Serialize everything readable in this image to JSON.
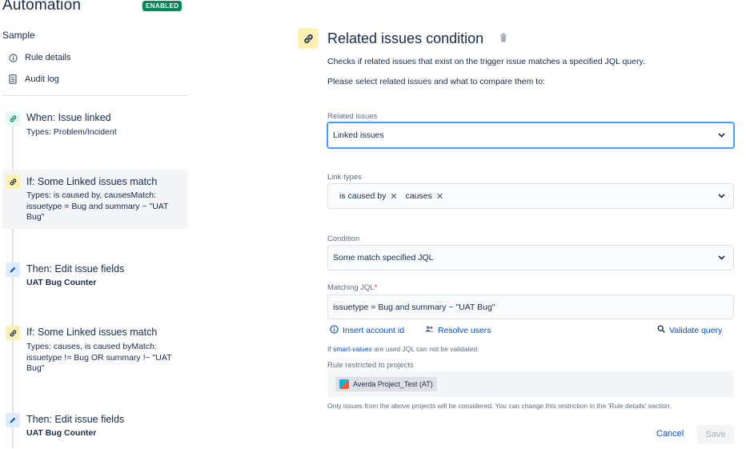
{
  "app": {
    "title": "Automation",
    "status_badge": "ENABLED"
  },
  "sidebar": {
    "rule_name": "Sample",
    "links": [
      {
        "label": "Rule details",
        "icon": "info-icon"
      },
      {
        "label": "Audit log",
        "icon": "document-icon"
      }
    ],
    "steps": [
      {
        "title": "When: Issue linked",
        "desc": "Types: Problem/Incident",
        "icon": "link-icon"
      },
      {
        "title": "If: Some Linked issues match",
        "desc": "Types: is caused by, causesMatch: issuetype = Bug and summary ~ \"UAT Bug\"",
        "icon": "link-icon",
        "selected": true
      },
      {
        "title": "Then: Edit issue fields",
        "bold": "UAT Bug Counter",
        "icon": "pencil-icon"
      },
      {
        "title": "If: Some Linked issues match",
        "desc": "Types: causes, is caused byMatch: issuetype != Bug OR summary !~ \"UAT Bug\"",
        "icon": "link-icon"
      },
      {
        "title": "Then: Edit issue fields",
        "bold": "UAT Bug Counter",
        "icon": "pencil-icon"
      }
    ]
  },
  "main": {
    "title": "Related issues condition",
    "description_1": "Checks if related issues that exist on the trigger issue matches a specified JQL query.",
    "description_2": "Please select related issues and what to compare them to:",
    "related_issues": {
      "label": "Related issues",
      "value": "Linked issues"
    },
    "link_types": {
      "label": "Link types",
      "tags": [
        "is caused by",
        "causes"
      ]
    },
    "condition": {
      "label": "Condition",
      "value": "Some match specified JQL"
    },
    "matching_jql": {
      "label": "Matching JQL",
      "required_mark": "*",
      "value": "issuetype = Bug and summary ~ \"UAT Bug\""
    },
    "actions": {
      "insert_account_id": "Insert account id",
      "resolve_users": "Resolve users",
      "validate_query": "Validate query"
    },
    "hint": {
      "prefix": "If ",
      "keyword": "smart-values",
      "suffix": " are used JQL can not be validated."
    },
    "restricted": {
      "label": "Rule restricted to projects",
      "project": "Averda Project_Test (AT)"
    },
    "footer_note": "Only issues from the above projects will be considered. You can change this restriction in the 'Rule details' section.",
    "buttons": {
      "cancel": "Cancel",
      "save": "Save"
    }
  },
  "colors": {
    "accent": "#0052cc",
    "enabled": "#00875a",
    "condition_bg": "#fff0b3",
    "trigger_bg": "#e3fcef",
    "action_bg": "#deebff"
  }
}
